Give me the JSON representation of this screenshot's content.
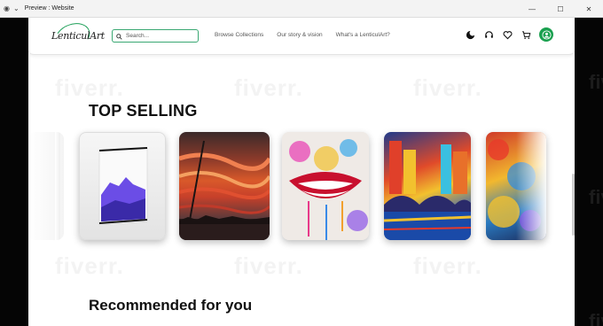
{
  "window": {
    "title": "Preview : Website",
    "controls": {
      "minimize": "—",
      "maximize": "☐",
      "close": "✕"
    }
  },
  "navbar": {
    "logo_text": "LenticulArt",
    "search_placeholder": "Search...",
    "links": [
      "Browse Collections",
      "Our story & vision",
      "What's a LenticulArt?"
    ],
    "icons": [
      "moon-icon",
      "headset-icon",
      "heart-icon",
      "cart-icon",
      "user-avatar-icon"
    ]
  },
  "sections": {
    "top_selling": "TOP SELLING",
    "recommended": "Recommended for you"
  },
  "watermark": "fiverr.",
  "products": [
    {
      "name": "lenticular-frame-purple-mountain"
    },
    {
      "name": "sunset-stripes-painting"
    },
    {
      "name": "colorful-lips-painting"
    },
    {
      "name": "city-bridge-painting"
    },
    {
      "name": "abstract-color-painting"
    }
  ],
  "colors": {
    "accent": "#1aa04f",
    "search_border": "#3aa873"
  }
}
